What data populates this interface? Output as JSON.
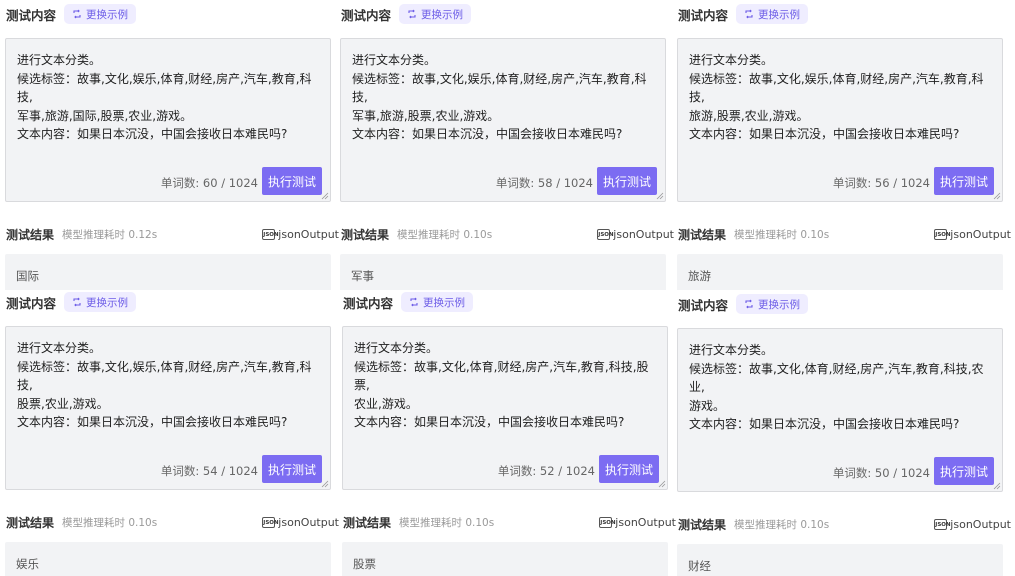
{
  "labels": {
    "panel_title": "测试内容",
    "swap_label": "更换示例",
    "run_label": "执行测试",
    "result_title": "测试结果",
    "json_label": "jsonOutput"
  },
  "panels": [
    {
      "prompt": "进行文本分类。\n候选标签：故事,文化,娱乐,体育,财经,房产,汽车,教育,科技,\n军事,旅游,国际,股票,农业,游戏。\n文本内容：如果日本沉没，中国会接收日本难民吗?",
      "count": "单词数: 60 / 1024",
      "time": "模型推理耗时 0.12s",
      "result": "国际"
    },
    {
      "prompt": "进行文本分类。\n候选标签：故事,文化,娱乐,体育,财经,房产,汽车,教育,科技,\n军事,旅游,股票,农业,游戏。\n文本内容：如果日本沉没，中国会接收日本难民吗?",
      "count": "单词数: 58 / 1024",
      "time": "模型推理耗时 0.10s",
      "result": "军事"
    },
    {
      "prompt": "进行文本分类。\n候选标签：故事,文化,娱乐,体育,财经,房产,汽车,教育,科技,\n旅游,股票,农业,游戏。\n文本内容：如果日本沉没，中国会接收日本难民吗?",
      "count": "单词数: 56 / 1024",
      "time": "模型推理耗时 0.10s",
      "result": "旅游"
    },
    {
      "prompt": "进行文本分类。\n候选标签：故事,文化,娱乐,体育,财经,房产,汽车,教育,科技,\n股票,农业,游戏。\n文本内容：如果日本沉没，中国会接收日本难民吗?",
      "count": "单词数: 54 / 1024",
      "time": "模型推理耗时 0.10s",
      "result": "娱乐"
    },
    {
      "prompt": "进行文本分类。\n候选标签：故事,文化,体育,财经,房产,汽车,教育,科技,股票,\n农业,游戏。\n文本内容：如果日本沉没，中国会接收日本难民吗?",
      "count": "单词数: 52 / 1024",
      "time": "模型推理耗时 0.10s",
      "result": "股票"
    },
    {
      "prompt": "进行文本分类。\n候选标签：故事,文化,体育,财经,房产,汽车,教育,科技,农业,\n游戏。\n文本内容：如果日本沉没，中国会接收日本难民吗?",
      "count": "单词数: 50 / 1024",
      "time": "模型推理耗时 0.10s",
      "result": "财经"
    }
  ]
}
